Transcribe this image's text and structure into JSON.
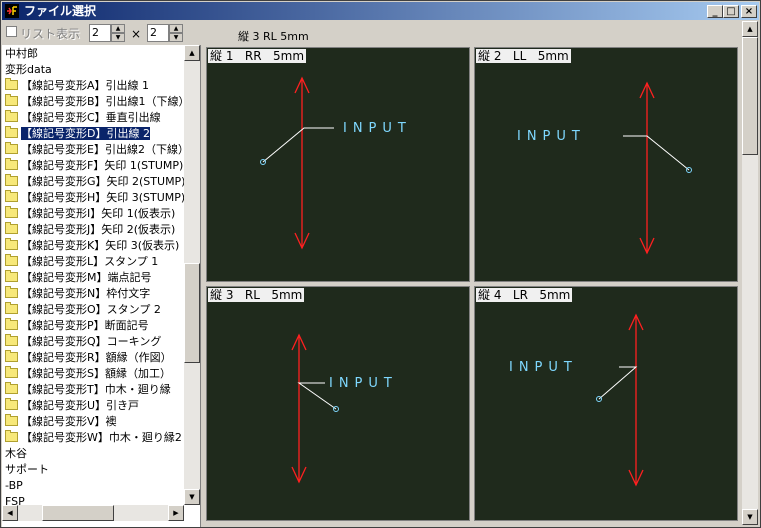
{
  "window": {
    "title": "ファイル選択"
  },
  "toolbar": {
    "list_label": "リスト表示",
    "cols": "2",
    "rows": "2",
    "times": "×",
    "status": "縦 3  RL  5mm"
  },
  "tree": {
    "top": [
      "中村郎",
      "変形data"
    ],
    "items": [
      "【線記号変形A】引出線 1",
      "【線記号変形B】引出線1（下線）",
      "【線記号変形C】垂直引出線",
      "【線記号変形D】引出線 2",
      "【線記号変形E】引出線2（下線）",
      "【線記号変形F】矢印 1(STUMP)",
      "【線記号変形G】矢印 2(STUMP)",
      "【線記号変形H】矢印 3(STUMP)",
      "【線記号変形I】矢印 1(仮表示)",
      "【線記号変形J】矢印 2(仮表示)",
      "【線記号変形K】矢印 3(仮表示)",
      "【線記号変形L】スタンプ  1",
      "【線記号変形M】端点記号",
      "【線記号変形N】枠付文字",
      "【線記号変形O】スタンプ  2",
      "【線記号変形P】断面記号",
      "【線記号変形Q】コーキング",
      "【線記号変形R】額縁（作図）",
      "【線記号変形S】額縁（加工）",
      "【線記号変形T】巾木・廻り縁",
      "【線記号変形U】引き戸",
      "【線記号変形V】襖",
      "【線記号変形W】巾木・廻り縁2"
    ],
    "selected_index": 3,
    "bottom": [
      "木谷",
      "サポート",
      "-BP",
      "FSP"
    ]
  },
  "panels": [
    {
      "title": "縦 1   RR   5mm",
      "label": "INPUT"
    },
    {
      "title": "縦 2   LL   5mm",
      "label": "INPUT"
    },
    {
      "title": "縦 3   RL   5mm",
      "label": "INPUT"
    },
    {
      "title": "縦 4   LR   5mm",
      "label": "INPUT"
    }
  ],
  "colors": {
    "arrow": "#ff2020",
    "leader": "#ffffff",
    "text": "#7fd8ff",
    "panel_bg": "#1f2a1c"
  }
}
